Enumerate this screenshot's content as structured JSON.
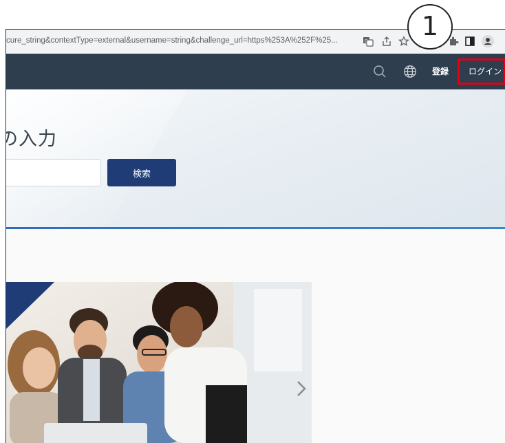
{
  "browser": {
    "url_fragment": "cure_string&contextType=external&username=string&challenge_url=https%253A%252F%25..."
  },
  "navbar": {
    "register_label": "登録",
    "login_label": "ログイン"
  },
  "hero": {
    "title": "の入力",
    "search_value": "",
    "search_button_label": "検索"
  },
  "annotation": {
    "step_number": "1"
  },
  "icons": [
    "translate-icon",
    "share-icon",
    "star-icon",
    "extension-icon",
    "sidepanel-icon",
    "profile-icon",
    "search-icon",
    "globe-icon",
    "chevron-right-icon"
  ],
  "colors": {
    "navbar": "#2e3e4e",
    "button": "#1f3c77",
    "highlight": "#e60012",
    "accent_line": "#2d6fb5"
  }
}
